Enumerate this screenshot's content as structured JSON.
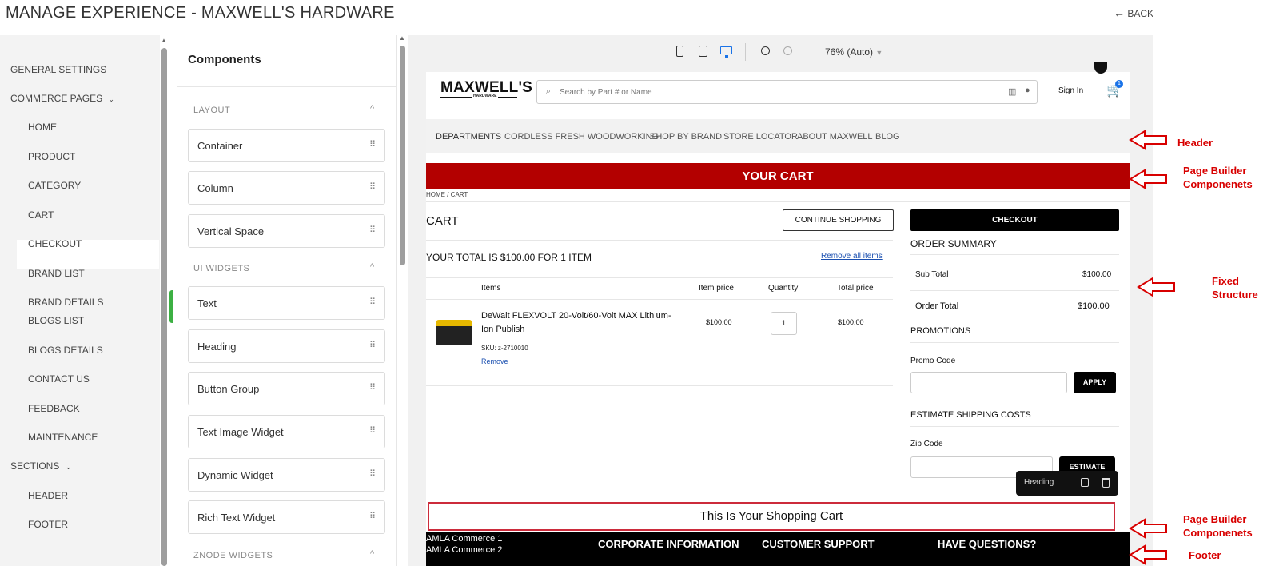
{
  "app": {
    "title": "MANAGE EXPERIENCE  -  MAXWELL'S HARDWARE",
    "back": "BACK"
  },
  "nav": {
    "general": "GENERAL SETTINGS",
    "commerce": "COMMERCE PAGES",
    "pages": [
      "HOME",
      "PRODUCT",
      "CATEGORY",
      "CART",
      "CHECKOUT",
      "BRAND LIST",
      "BRAND DETAILS",
      "BLOGS LIST",
      "BLOGS DETAILS",
      "CONTACT US",
      "FEEDBACK",
      "MAINTENANCE"
    ],
    "sections": "SECTIONS",
    "section_items": [
      "HEADER",
      "FOOTER"
    ]
  },
  "components": {
    "title": "Components",
    "layout_label": "LAYOUT",
    "layout": [
      "Container",
      "Column",
      "Vertical Space"
    ],
    "ui_label": "UI WIDGETS",
    "ui": [
      "Text",
      "Heading",
      "Button Group",
      "Text Image Widget",
      "Dynamic Widget",
      "Rich Text Widget"
    ],
    "znode_label": "ZNODE WIDGETS"
  },
  "toolbar": {
    "zoom": "76% (Auto)"
  },
  "store": {
    "logo": "MAXWELL'S",
    "logo_sub": "HARDWARE",
    "search_placeholder": "Search by Part # or Name",
    "sign_in": "Sign In",
    "cart_count": "1",
    "menu": [
      "DEPARTMENTS",
      "CORDLESS FRESH WOODWORKING",
      "SHOP BY BRAND",
      "STORE LOCATOR",
      "ABOUT MAXWELL",
      "BLOG"
    ],
    "banner": "YOUR CART",
    "breadcrumb": "HOME / CART",
    "cart_title": "CART",
    "continue": "CONTINUE SHOPPING",
    "total_text": "YOUR TOTAL IS $100.00 FOR 1 ITEM",
    "remove_all": "Remove all items",
    "cols": [
      "Items",
      "Item price",
      "Quantity",
      "Total price"
    ],
    "item": {
      "name": "DeWalt FLEXVOLT 20-Volt/60-Volt MAX Lithium-Ion Publish",
      "sku": "SKU: z-2710010",
      "remove": "Remove",
      "price": "$100.00",
      "qty": "1",
      "total": "$100.00"
    },
    "checkout": "CHECKOUT",
    "order_summary": "ORDER SUMMARY",
    "subtotal_label": "Sub Total",
    "subtotal": "$100.00",
    "ordertotal_label": "Order Total",
    "ordertotal": "$100.00",
    "promotions": "PROMOTIONS",
    "promo_label": "Promo Code",
    "apply": "APPLY",
    "shipping": "ESTIMATE SHIPPING COSTS",
    "zip_label": "Zip Code",
    "estimate": "ESTIMATE",
    "widget_tag": "Heading",
    "heading": "This Is Your Shopping Cart",
    "footer_left": [
      "AMLA Commerce 1",
      "AMLA Commerce 2"
    ],
    "footer_cols": [
      "CORPORATE INFORMATION",
      "CUSTOMER SUPPORT",
      "HAVE QUESTIONS?"
    ]
  },
  "annotations": {
    "header": "Header",
    "pb1": "Page Builder Componenets",
    "fixed": "Fixed Structure",
    "pb2": "Page Builder Componenets",
    "footer": "Footer"
  },
  "colors": {
    "banner": "#b30000",
    "annotation": "#d80000",
    "accent": "#1a73e8",
    "black": "#000000"
  }
}
